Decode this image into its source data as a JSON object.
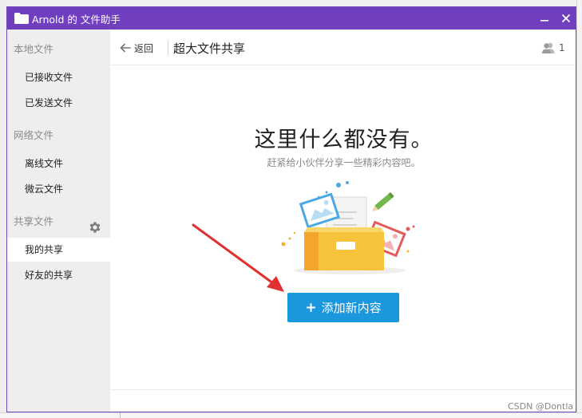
{
  "window": {
    "title": "Arnold 的 文件助手",
    "minimize_icon": "minimize-icon",
    "close_icon": "close-icon",
    "title_bar_color": "#6f3fbf"
  },
  "sidebar": {
    "local_title": "本地文件",
    "local_items": [
      {
        "label": "已接收文件"
      },
      {
        "label": "已发送文件"
      }
    ],
    "network_title": "网络文件",
    "network_items": [
      {
        "label": "离线文件"
      },
      {
        "label": "微云文件"
      }
    ],
    "shared_title": "共享文件",
    "shared_items": [
      {
        "label": "我的共享",
        "active": true
      },
      {
        "label": "好友的共享"
      }
    ],
    "settings_icon": "gear-icon"
  },
  "header": {
    "back_label": "返回",
    "page_title": "超大文件共享",
    "member_count": "1"
  },
  "empty_state": {
    "title": "这里什么都没有。",
    "subtitle": "赶紧给小伙伴分享一些精彩内容吧。",
    "add_button_label": "添加新内容",
    "add_button_color": "#1a97dd"
  },
  "watermark": "CSDN @Dontla"
}
